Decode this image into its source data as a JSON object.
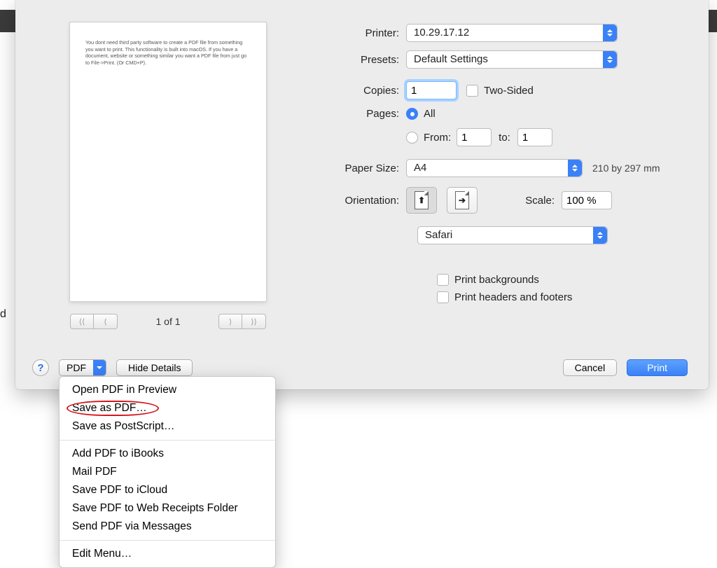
{
  "preview": {
    "body_text": "You dont need third party software to create a PDF file from something you want to print. This functionality is built into macOS. If you have a document, website or something similar you want a PDF file from just go to File->Print. (Or CMD+P).",
    "page_indicator": "1 of 1"
  },
  "settings": {
    "printer_label": "Printer:",
    "printer_value": "10.29.17.12",
    "presets_label": "Presets:",
    "presets_value": "Default Settings",
    "copies_label": "Copies:",
    "copies_value": "1",
    "two_sided_label": "Two-Sided",
    "pages_label": "Pages:",
    "pages_all": "All",
    "pages_from_label": "From:",
    "pages_from_value": "1",
    "pages_to_label": "to:",
    "pages_to_value": "1",
    "paper_size_label": "Paper Size:",
    "paper_size_value": "A4",
    "paper_dims": "210 by 297 mm",
    "orientation_label": "Orientation:",
    "scale_label": "Scale:",
    "scale_value": "100 %",
    "app_value": "Safari",
    "print_backgrounds": "Print backgrounds",
    "print_headers": "Print headers and footers"
  },
  "footer": {
    "help": "?",
    "pdf": "PDF",
    "hide_details": "Hide Details",
    "cancel": "Cancel",
    "print": "Print"
  },
  "dropdown": {
    "items_a": [
      "Open PDF in Preview",
      "Save as PDF…",
      "Save as PostScript…"
    ],
    "items_b": [
      "Add PDF to iBooks",
      "Mail PDF",
      "Save PDF to iCloud",
      "Save PDF to Web Receipts Folder",
      "Send PDF via Messages"
    ],
    "items_c": [
      "Edit Menu…"
    ]
  }
}
